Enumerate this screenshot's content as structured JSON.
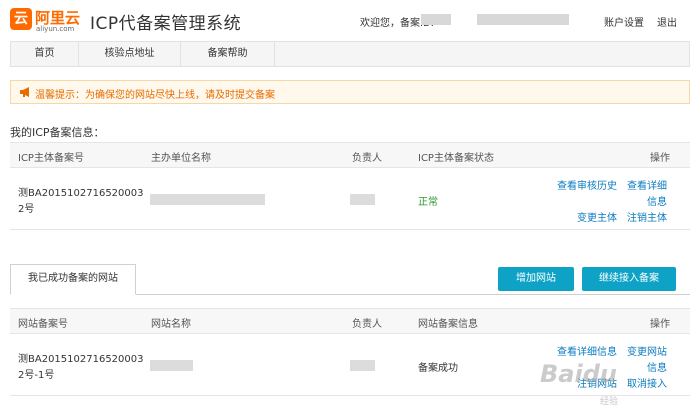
{
  "header": {
    "logo_mark": "云",
    "logo_cn": "阿里云",
    "logo_en": "aliyun.com",
    "system_title": "ICP代备案管理系统",
    "welcome": "欢迎您，备案ID:",
    "account_settings": "账户设置",
    "logout": "退出"
  },
  "nav": {
    "items": [
      {
        "label": "首页"
      },
      {
        "label": "核验点地址"
      },
      {
        "label": "备案帮助"
      }
    ]
  },
  "notice": {
    "icon": "megaphone-icon",
    "text": "温馨提示：为确保您的网站尽快上线，请及时提交备案"
  },
  "subject": {
    "section_title": "我的ICP备案信息：",
    "columns": [
      "ICP主体备案号",
      "主办单位名称",
      "负责人",
      "ICP主体备案状态",
      "操作"
    ],
    "row": {
      "record_no_line1": "测BA2015102716520003",
      "record_no_line2": "2号",
      "status": "正常",
      "actions": [
        "查看审核历史",
        "查看详细",
        "信息",
        "变更主体",
        "注销主体"
      ]
    }
  },
  "sites": {
    "tab_label": "我已成功备案的网站",
    "add_site": "增加网站",
    "continue_access": "继续接入备案",
    "columns": [
      "网站备案号",
      "网站名称",
      "负责人",
      "网站备案信息",
      "操作"
    ],
    "row": {
      "record_no_line1": "测BA2015102716520003",
      "record_no_line2": "2号-1号",
      "info": "备案成功",
      "actions": [
        "查看详细信息",
        "变更网站",
        "信息",
        "注销网站",
        "取消接入"
      ]
    }
  },
  "watermark": {
    "text": "Baidu",
    "sub": "经验"
  },
  "colors": {
    "brand_orange": "#ff6a00",
    "link_blue": "#0a7bbf",
    "button_blue": "#0ea3c6",
    "notice_orange": "#e66c00",
    "status_green": "#2b9a2b"
  }
}
